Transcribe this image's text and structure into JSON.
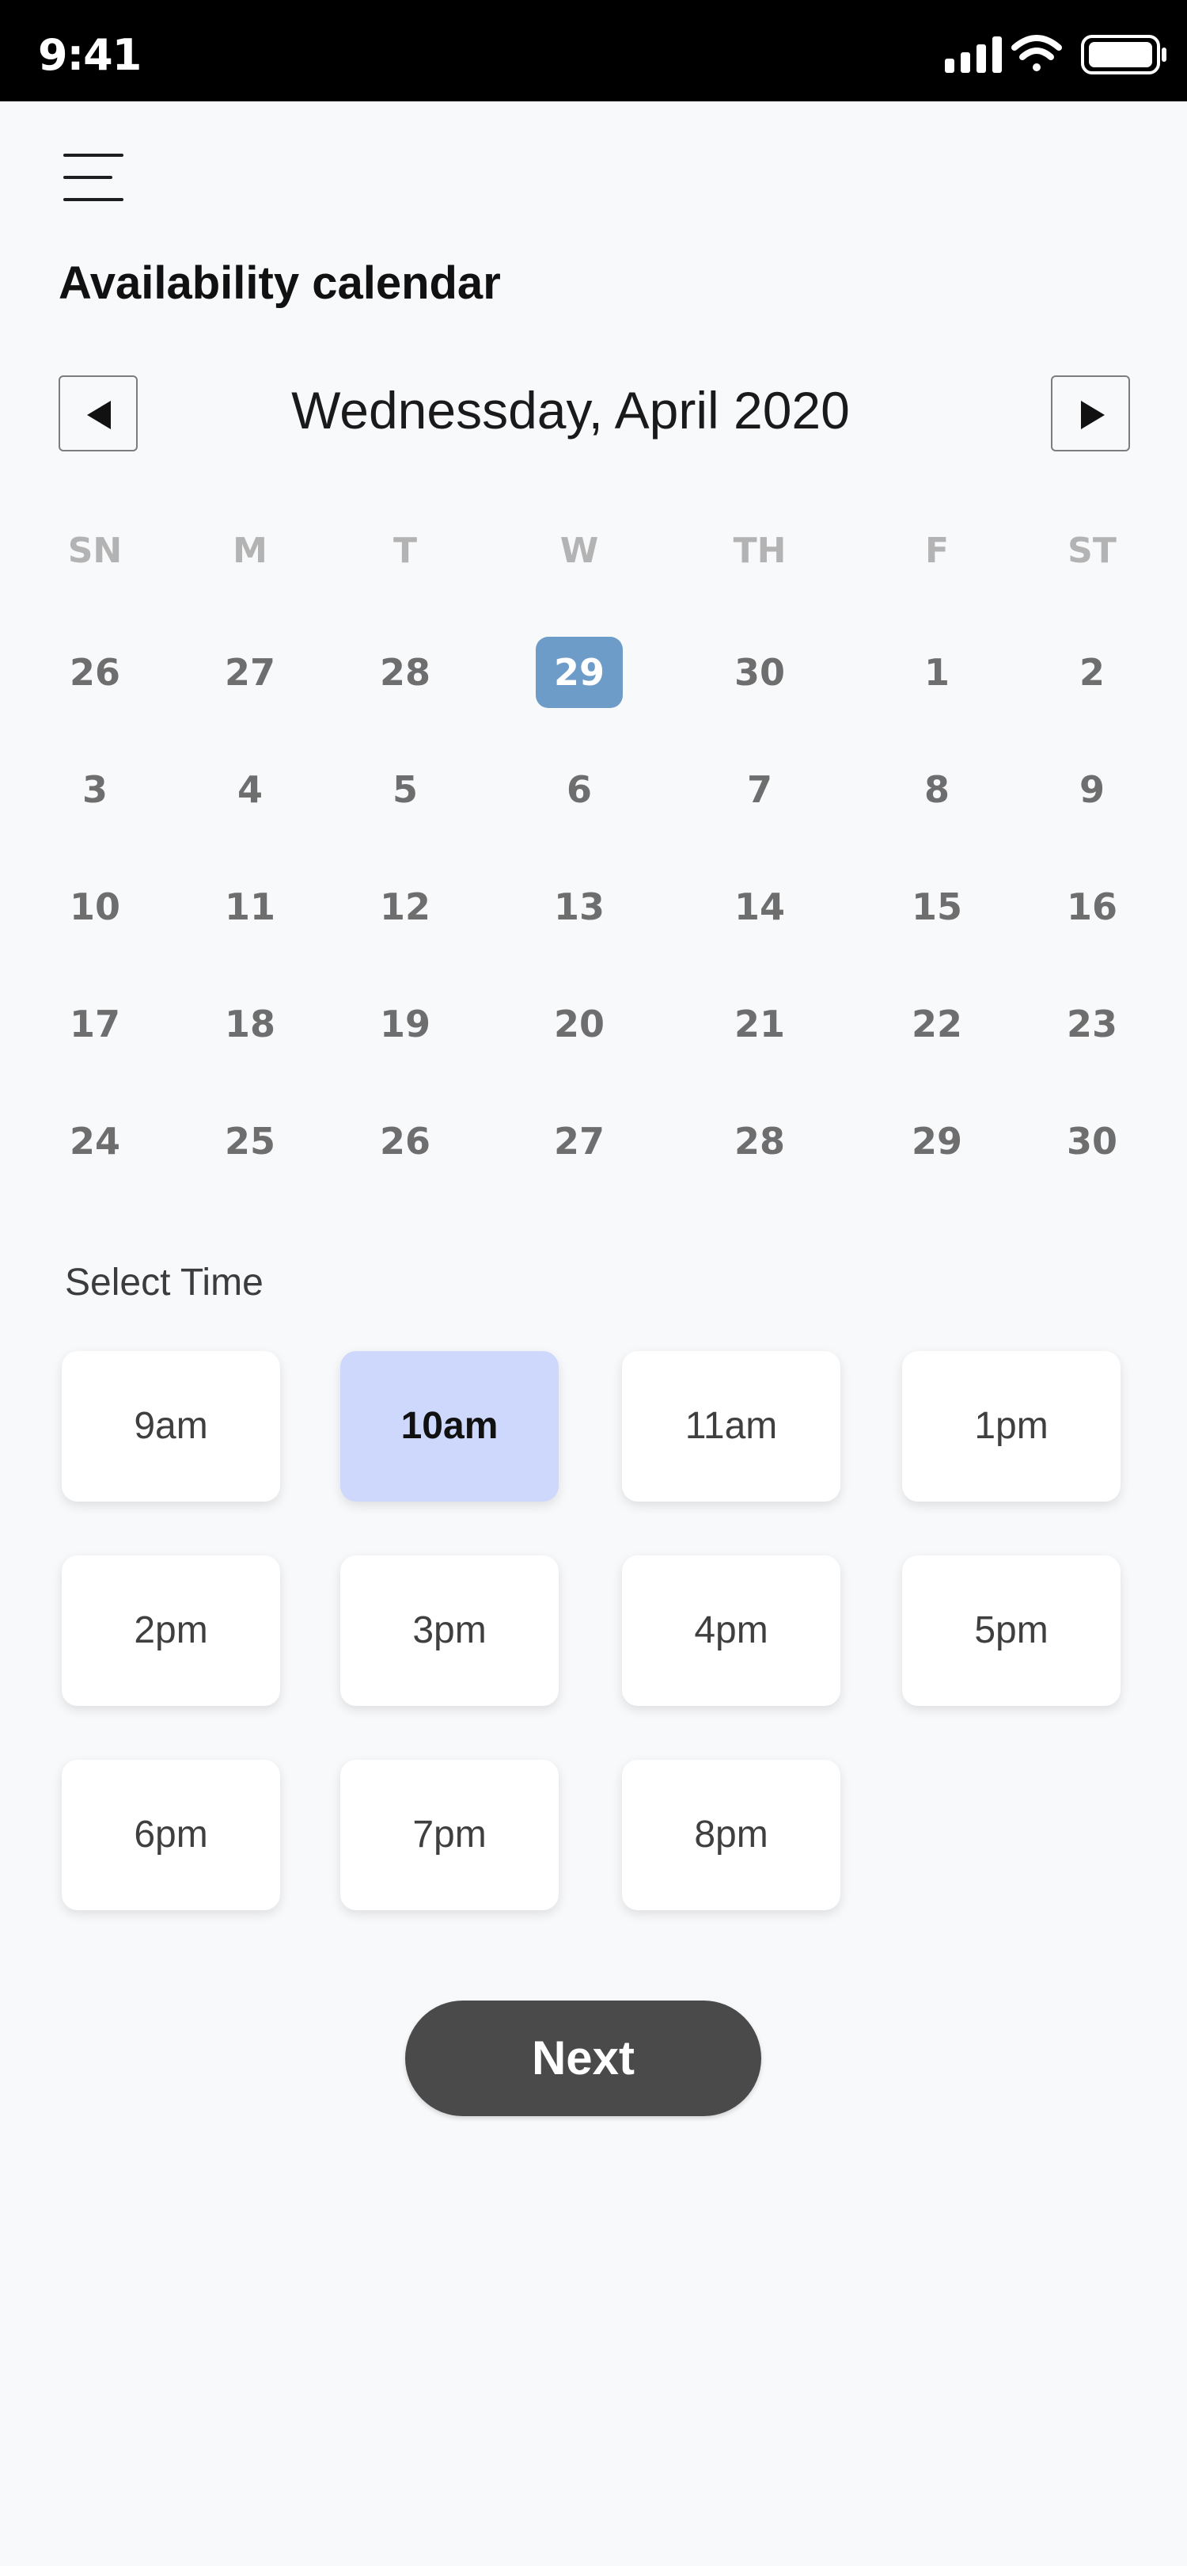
{
  "status_bar": {
    "time": "9:41"
  },
  "header": {
    "title": "Availability calendar"
  },
  "calendar": {
    "month_label": "Wednessday, April 2020",
    "weekdays": [
      "SN",
      "M",
      "T",
      "W",
      "TH",
      "F",
      "ST"
    ],
    "weeks": [
      [
        "26",
        "27",
        "28",
        "29",
        "30",
        "1",
        "2"
      ],
      [
        "3",
        "4",
        "5",
        "6",
        "7",
        "8",
        "9"
      ],
      [
        "10",
        "11",
        "12",
        "13",
        "14",
        "15",
        "16"
      ],
      [
        "17",
        "18",
        "19",
        "20",
        "21",
        "22",
        "23"
      ],
      [
        "24",
        "25",
        "26",
        "27",
        "28",
        "29",
        "30"
      ]
    ],
    "selected_day": "29",
    "selected_color": "#6e9cc9"
  },
  "time_picker": {
    "label": "Select Time",
    "slots": [
      "9am",
      "10am",
      "11am",
      "1pm",
      "2pm",
      "3pm",
      "4pm",
      "5pm",
      "6pm",
      "7pm",
      "8pm"
    ],
    "selected_slot": "10am",
    "selected_color": "#cdd8fc"
  },
  "actions": {
    "next_label": "Next"
  },
  "icons": {
    "menu": "hamburger-menu-icon",
    "prev": "caret-left-icon",
    "next": "caret-right-icon",
    "signal": "cellular-signal-icon",
    "wifi": "wifi-icon",
    "battery": "battery-icon"
  }
}
